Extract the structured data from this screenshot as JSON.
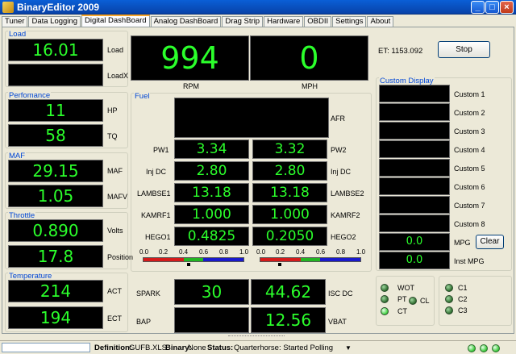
{
  "window": {
    "title": "BinaryEditor 2009"
  },
  "tabs": [
    "Tuner",
    "Data Logging",
    "Digital DashBoard",
    "Analog DashBoard",
    "Drag Strip",
    "Hardware",
    "OBDII",
    "Settings",
    "About"
  ],
  "groups": {
    "load": "Load",
    "performance": "Perfomance",
    "maf": "MAF",
    "throttle": "Throttle",
    "temperature": "Temperature",
    "fuel": "Fuel",
    "custom": "Custom Display"
  },
  "load": {
    "value": "16.01",
    "label": "Load",
    "load2_value": "",
    "load2_label": "LoadX"
  },
  "perf": {
    "hp": "11",
    "hp_label": "HP",
    "tq": "58",
    "tq_label": "TQ"
  },
  "maf": {
    "maf": "29.15",
    "maf_label": "MAF",
    "mafv": "1.05",
    "mafv_label": "MAFV"
  },
  "throttle": {
    "volts": "0.890",
    "volts_label": "Volts",
    "position": "17.8",
    "position_label": "Position"
  },
  "temperature": {
    "act": "214",
    "act_label": "ACT",
    "ect": "194",
    "ect_label": "ECT"
  },
  "big": {
    "rpm": "994",
    "rpm_label": "RPM",
    "mph": "0",
    "mph_label": "MPH"
  },
  "et": "ET: 1153.092",
  "stop_label": "Stop",
  "fuel": {
    "afr_label": "AFR",
    "afr": "",
    "pw1_label": "PW1",
    "pw1": "3.34",
    "pw2": "3.32",
    "pw2_label": "PW2",
    "injdc_label": "Inj DC",
    "injdc1": "2.80",
    "injdc2": "2.80",
    "injdc2_label": "Inj DC",
    "lambse1_label": "LAMBSE1",
    "lambse1": "13.18",
    "lambse2": "13.18",
    "lambse2_label": "LAMBSE2",
    "kamrf1_label": "KAMRF1",
    "kamrf1": "1.000",
    "kamrf2": "1.000",
    "kamrf2_label": "KAMRF2",
    "hego1_label": "HEGO1",
    "hego1": "0.4825",
    "hego2": "0.2050",
    "hego2_label": "HEGO2",
    "scale": [
      "0.0",
      "0.2",
      "0.4",
      "0.6",
      "0.8",
      "1.0"
    ],
    "hego1_level": 0.45,
    "hego2_level": 0.2
  },
  "spark": {
    "spark_label": "SPARK",
    "spark": "30",
    "isc": "44.62",
    "isc_label": "ISC DC",
    "bap_label": "BAP",
    "bap": "",
    "vbat": "12.56",
    "vbat_label": "VBAT"
  },
  "custom": {
    "labels": [
      "Custom 1",
      "Custom 2",
      "Custom 3",
      "Custom 4",
      "Custom 5",
      "Custom 6",
      "Custom 7",
      "Custom 8"
    ],
    "mpg": "0.0",
    "mpg_label": "MPG",
    "inst_mpg": "0.0",
    "inst_mpg_label": "Inst MPG",
    "clear_label": "Clear"
  },
  "indicators": {
    "wot": "WOT",
    "pt": "PT",
    "cl": "CL",
    "ct": "CT",
    "c1": "C1",
    "c2": "C2",
    "c3": "C3"
  },
  "status": {
    "def_label": "Definition:",
    "def": "GUFB.XLS",
    "bin_label": "Binary:",
    "bin": "None",
    "stat_label": "Status:",
    "stat": "Quarterhorse: Started Polling"
  },
  "colors": {
    "display_text": "#2bff2b",
    "display_bg": "#000000",
    "group_label": "#0046d5"
  }
}
